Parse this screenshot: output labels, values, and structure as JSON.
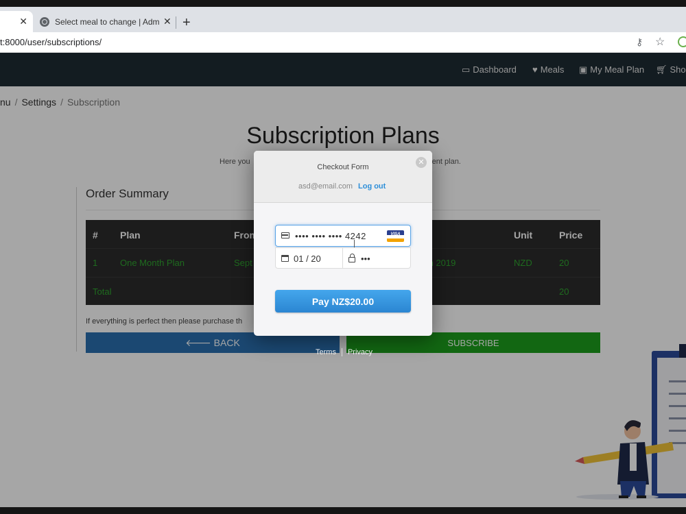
{
  "browser": {
    "tabs": [
      {
        "label": "",
        "active": true
      },
      {
        "label": "Select meal to change | Admin Pa",
        "active": false
      }
    ],
    "url": "t:8000/user/subscriptions/"
  },
  "navbar": {
    "items": [
      {
        "label": "Dashboard",
        "icon": "monitor-icon"
      },
      {
        "label": "Meals",
        "icon": "heart-icon"
      },
      {
        "label": "My Meal Plan",
        "icon": "clipboard-icon"
      },
      {
        "label": "Shop",
        "icon": "cart-icon"
      }
    ]
  },
  "breadcrumb": [
    "nu",
    "Settings",
    "Subscription"
  ],
  "page": {
    "title": "Subscription Plans",
    "subtitle_left": "Here you",
    "subtitle_right": "rent plan.",
    "summary_title": "Order Summary",
    "purchase_note": "If everything is perfect then please purchase th",
    "back_label": "BACK",
    "subscribe_label": "SUBSCRIBE"
  },
  "table": {
    "headers": [
      "#",
      "Plan",
      "From",
      "Unit",
      "Price"
    ],
    "row": {
      "num": "1",
      "plan": "One Month Plan",
      "from": "Sept",
      "to_partial": "th 2019",
      "unit": "NZD",
      "price": "20"
    },
    "total_label": "Total",
    "total_value": "20"
  },
  "checkout": {
    "title": "Checkout Form",
    "email": "asd@email.com",
    "logout_label": "Log out",
    "card_number": "•••• •••• •••• 4242",
    "card_brand": "VISA",
    "expiry": "01 / 20",
    "cvc": "•••",
    "pay_label": "Pay NZ$20.00"
  },
  "footer": {
    "terms": "Terms",
    "privacy": "Privacy"
  },
  "colors": {
    "navbar": "#1e2b33",
    "accent_blue": "#2e8fd9",
    "success_green": "#1d9f1d",
    "table_text_green": "#2fa52f"
  }
}
